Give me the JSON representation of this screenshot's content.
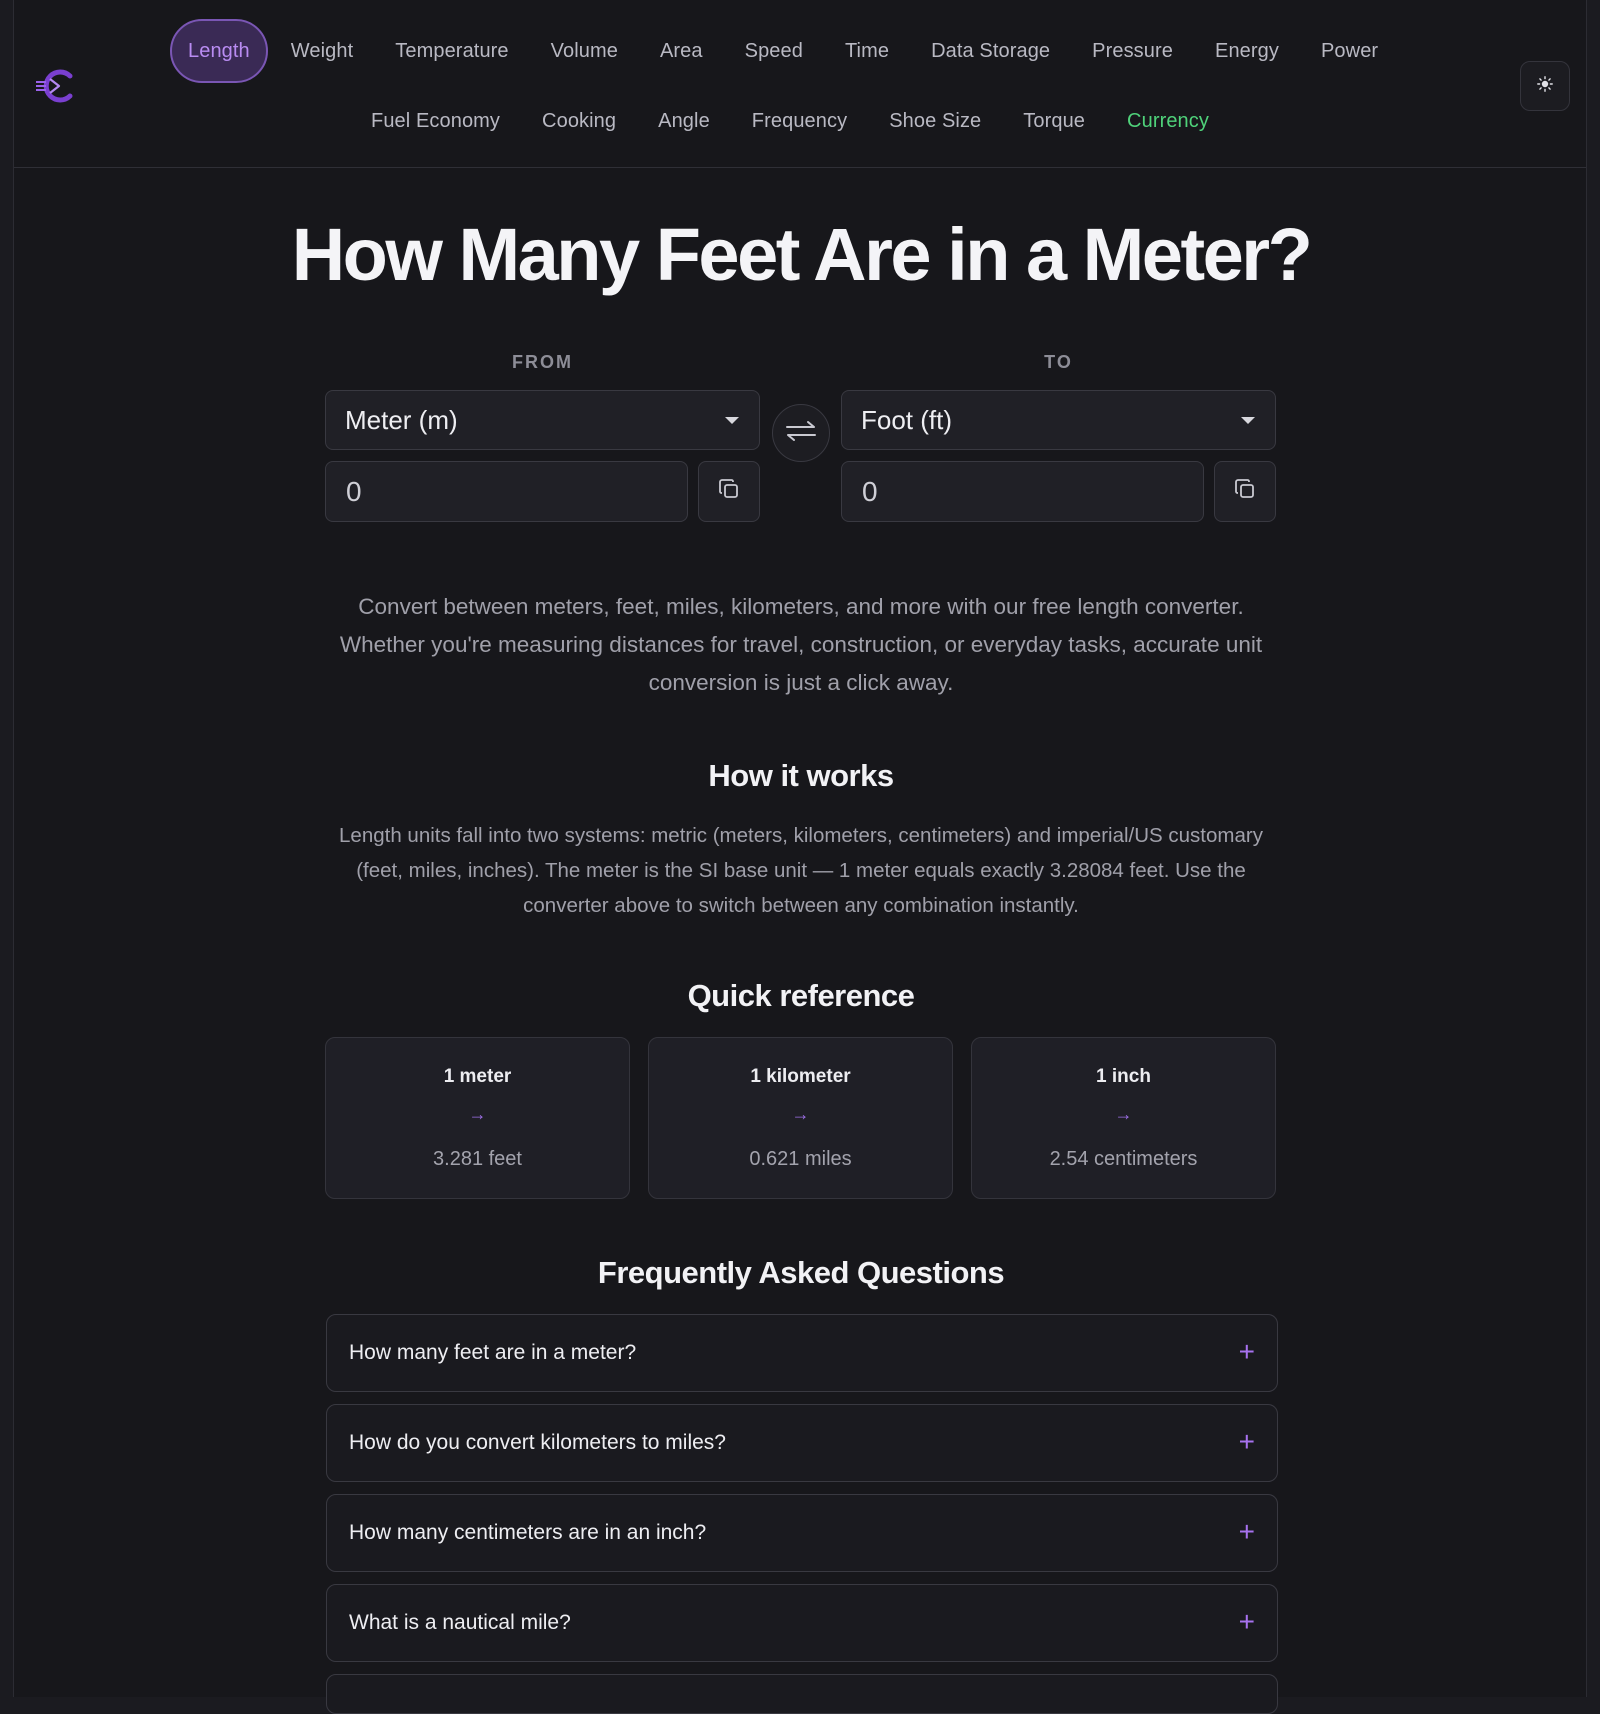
{
  "nav": {
    "row1": [
      "Length",
      "Weight",
      "Temperature",
      "Volume",
      "Area",
      "Speed",
      "Time",
      "Data Storage",
      "Pressure",
      "Energy",
      "Power"
    ],
    "row2": [
      "Fuel Economy",
      "Cooking",
      "Angle",
      "Frequency",
      "Shoe Size",
      "Torque",
      "Currency"
    ],
    "active": "Length"
  },
  "icons": {
    "logo": "logo-icon",
    "theme": "sun-icon",
    "swap": "swap-arrows-icon",
    "copy": "copy-icon",
    "faq_expand": "plus-icon"
  },
  "colors": {
    "accent": "#a772ef",
    "active_tab_bg": "#3a2a55",
    "currency": "#4fd27a",
    "background": "#17171b"
  },
  "page_title": "How Many Feet Are in a Meter?",
  "converter": {
    "from_label": "FROM",
    "to_label": "TO",
    "from_unit": "Meter (m)",
    "to_unit": "Foot (ft)",
    "from_value": "0",
    "to_value": "0"
  },
  "intro": "Convert between meters, feet, miles, kilometers, and more with our free length converter. Whether you're measuring distances for travel, construction, or everyday tasks, accurate unit conversion is just a click away.",
  "how_it_works": {
    "heading": "How it works",
    "text": "Length units fall into two systems: metric (meters, kilometers, centimeters) and imperial/US customary (feet, miles, inches). The meter is the SI base unit — 1 meter equals exactly 3.28084 feet. Use the converter above to switch between any combination instantly."
  },
  "quick_reference": {
    "heading": "Quick reference",
    "cards": [
      {
        "from": "1 meter",
        "arrow": "→",
        "to": "3.281 feet"
      },
      {
        "from": "1 kilometer",
        "arrow": "→",
        "to": "0.621 miles"
      },
      {
        "from": "1 inch",
        "arrow": "→",
        "to": "2.54 centimeters"
      }
    ]
  },
  "faq": {
    "heading": "Frequently Asked Questions",
    "items": [
      "How many feet are in a meter?",
      "How do you convert kilometers to miles?",
      "How many centimeters are in an inch?",
      "What is a nautical mile?"
    ],
    "plus": "+"
  }
}
